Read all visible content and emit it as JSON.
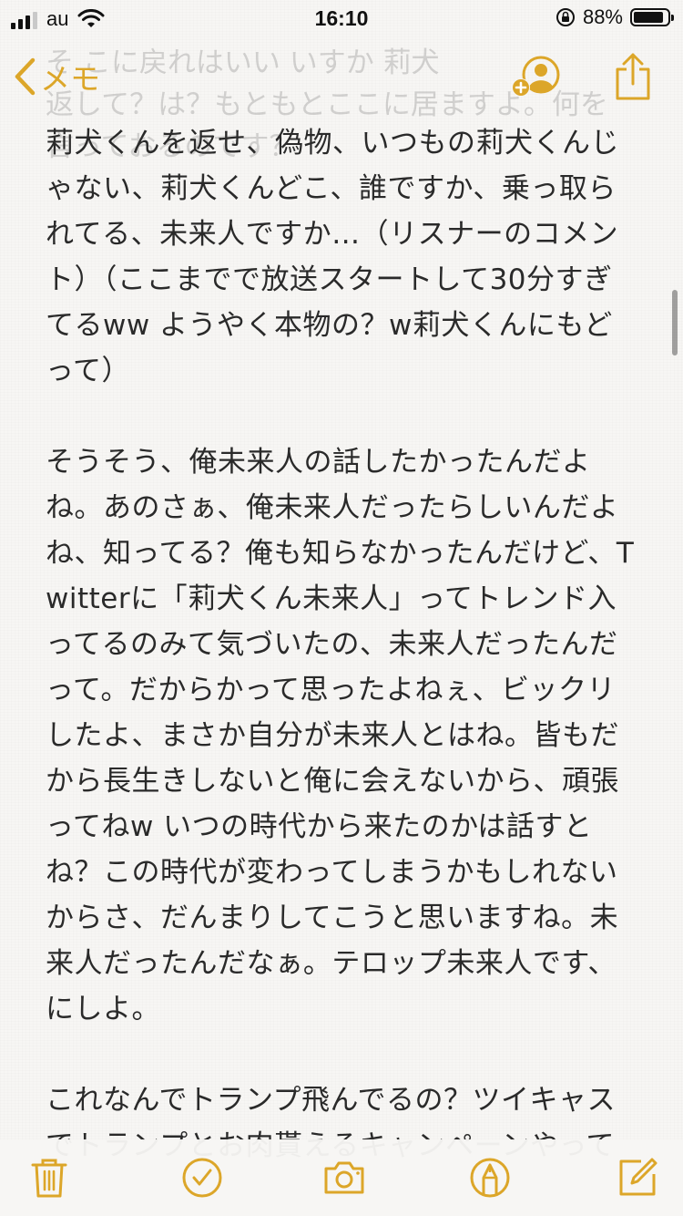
{
  "status_bar": {
    "carrier": "au",
    "time": "16:10",
    "battery_percent_text": "88%",
    "battery_level": 0.88
  },
  "nav": {
    "back_label": "メモ",
    "icons": {
      "back": "chevron-left-icon",
      "add_person": "add-person-icon",
      "share": "share-icon"
    }
  },
  "ghost_lines": [
    "そ こに戻れはいい いすか 莉犬",
    "返して？は？もともとここに居ますよ。何を",
    "言っておるのです？"
  ],
  "note": {
    "paragraphs": [
      "莉犬くんを返せ、偽物、いつもの莉犬くんじゃない、莉犬くんどこ、誰ですか、乗っ取られてる、未来人ですか…（リスナーのコメント）（ここまでで放送スタートして30分すぎてるww ようやく本物の？w莉犬くんにもどって）",
      "そうそう、俺未来人の話したかったんだよね。あのさぁ、俺未来人だったらしいんだよね、知ってる？俺も知らなかったんだけど、Twitterに「莉犬くん未来人」ってトレンド入ってるのみて気づいたの、未来人だったんだって。だからかって思ったよねぇ、ビックリしたよ、まさか自分が未来人とはね。皆もだから長生きしないと俺に会えないから、頑張ってねw いつの時代から来たのかは話すとね？この時代が変わってしまうかもしれないからさ、だんまりしてこうと思いますね。未来人だったんだなぁ。テロップ未来人です、にしよ。",
      "これなんでトランプ飛んでるの？ツイキャスでトランプとお肉貰えるキャンペーンやって"
    ]
  },
  "toolbar": {
    "icons": [
      "trash-icon",
      "checkmark-circle-icon",
      "camera-icon",
      "markup-pen-icon",
      "compose-icon"
    ]
  },
  "colors": {
    "accent": "#dca629",
    "text": "#2a2a2a",
    "background": "#f7f6f4"
  }
}
